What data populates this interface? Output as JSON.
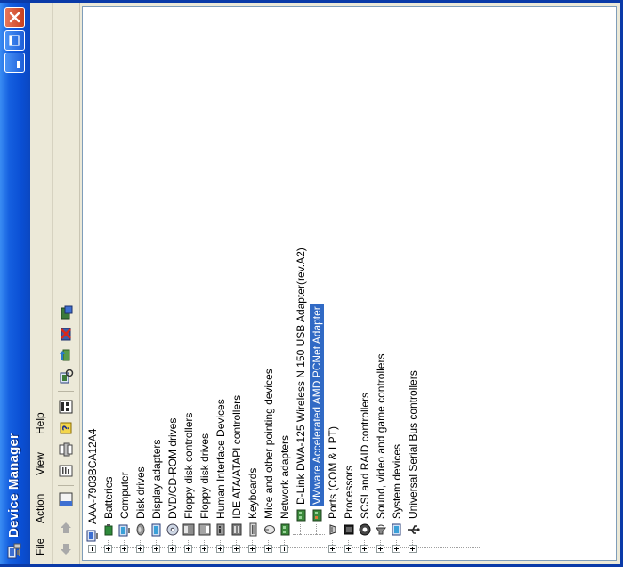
{
  "window": {
    "title": "Device Manager",
    "accent_color": "#0a4fd4",
    "close_color": "#c8401f",
    "selection_color": "#316ac5"
  },
  "menu": [
    "File",
    "Action",
    "View",
    "Help"
  ],
  "toolbar_icons": [
    "back-icon",
    "forward-icon",
    "console-tree-icon",
    "properties-icon",
    "print-icon",
    "help-icon",
    "view-icon",
    "scan-hardware-icon",
    "update-driver-icon",
    "uninstall-icon",
    "disable-icon"
  ],
  "tree": {
    "root": "AAA-7903BCA12A4",
    "categories": [
      {
        "label": "Batteries",
        "icon": "battery-icon"
      },
      {
        "label": "Computer",
        "icon": "computer-icon"
      },
      {
        "label": "Disk drives",
        "icon": "disk-drive-icon"
      },
      {
        "label": "Display adapters",
        "icon": "display-adapter-icon"
      },
      {
        "label": "DVD/CD-ROM drives",
        "icon": "cdrom-icon"
      },
      {
        "label": "Floppy disk controllers",
        "icon": "floppy-controller-icon"
      },
      {
        "label": "Floppy disk drives",
        "icon": "floppy-drive-icon"
      },
      {
        "label": "Human Interface Devices",
        "icon": "hid-icon"
      },
      {
        "label": "IDE ATA/ATAPI controllers",
        "icon": "ide-controller-icon"
      },
      {
        "label": "Keyboards",
        "icon": "keyboard-icon"
      },
      {
        "label": "Mice and other pointing devices",
        "icon": "mouse-icon"
      },
      {
        "label": "Network adapters",
        "icon": "network-adapter-icon",
        "expanded": true,
        "children": [
          {
            "label": "D-Link DWA-125 Wireless N 150 USB Adapter(rev.A2)",
            "icon": "network-card-icon"
          },
          {
            "label": "VMware Accelerated AMD PCNet Adapter",
            "icon": "network-card-icon",
            "selected": true
          }
        ]
      },
      {
        "label": "Ports (COM & LPT)",
        "icon": "port-icon"
      },
      {
        "label": "Processors",
        "icon": "processor-icon"
      },
      {
        "label": "SCSI and RAID controllers",
        "icon": "scsi-icon"
      },
      {
        "label": "Sound, video and game controllers",
        "icon": "sound-icon"
      },
      {
        "label": "System devices",
        "icon": "system-device-icon"
      },
      {
        "label": "Universal Serial Bus controllers",
        "icon": "usb-icon"
      }
    ]
  }
}
